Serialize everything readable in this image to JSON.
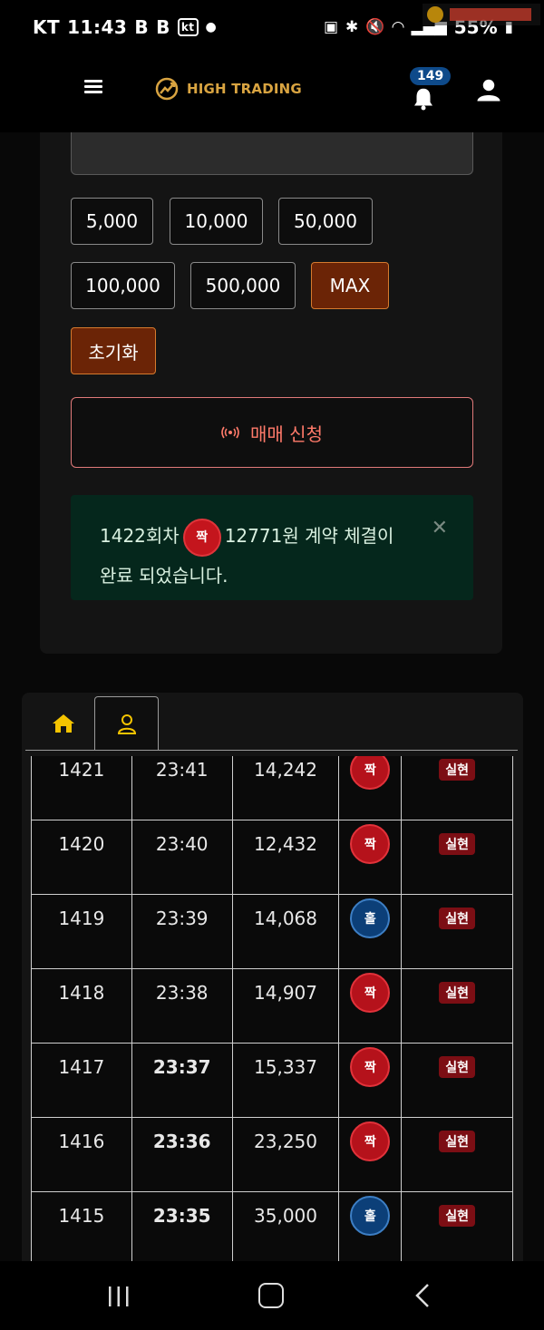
{
  "status_bar": {
    "carrier": "KT",
    "time": "11:43",
    "badge_b1": "B",
    "badge_b2": "B",
    "kt_icon": "kt",
    "battery": "55%"
  },
  "header": {
    "logo_text": "HIGH TRADING",
    "notification_count": "149"
  },
  "amounts": {
    "a1": "5,000",
    "a2": "10,000",
    "a3": "50,000",
    "a4": "100,000",
    "a5": "500,000",
    "max": "MAX",
    "reset": "초기화"
  },
  "trade_button": {
    "label": "매매 신청"
  },
  "alert": {
    "round_text": "1422회차",
    "badge": "짝",
    "line1_rest": "12771원 계약 체결이",
    "line2": "완료 되었습니다."
  },
  "table": {
    "rows": [
      {
        "round": "1421",
        "time": "23:41",
        "amount": "14,242",
        "result": "짝",
        "result_color": "#b5121b",
        "status": "실현",
        "bold": false
      },
      {
        "round": "1420",
        "time": "23:40",
        "amount": "12,432",
        "result": "짝",
        "result_color": "#b5121b",
        "status": "실현",
        "bold": false
      },
      {
        "round": "1419",
        "time": "23:39",
        "amount": "14,068",
        "result": "홀",
        "result_color": "#0c3f78",
        "status": "실현",
        "bold": false
      },
      {
        "round": "1418",
        "time": "23:38",
        "amount": "14,907",
        "result": "짝",
        "result_color": "#b5121b",
        "status": "실현",
        "bold": false
      },
      {
        "round": "1417",
        "time": "23:37",
        "amount": "15,337",
        "result": "짝",
        "result_color": "#b5121b",
        "status": "실현",
        "bold": true
      },
      {
        "round": "1416",
        "time": "23:36",
        "amount": "23,250",
        "result": "짝",
        "result_color": "#b5121b",
        "status": "실현",
        "bold": true
      },
      {
        "round": "1415",
        "time": "23:35",
        "amount": "35,000",
        "result": "홀",
        "result_color": "#0c3f78",
        "status": "실현",
        "bold": true
      }
    ]
  },
  "colors": {
    "accent_gold": "#d9a441",
    "accent_orange": "#6b2406",
    "alert_bg": "#05271c",
    "badge_blue": "#0e4a8a"
  }
}
